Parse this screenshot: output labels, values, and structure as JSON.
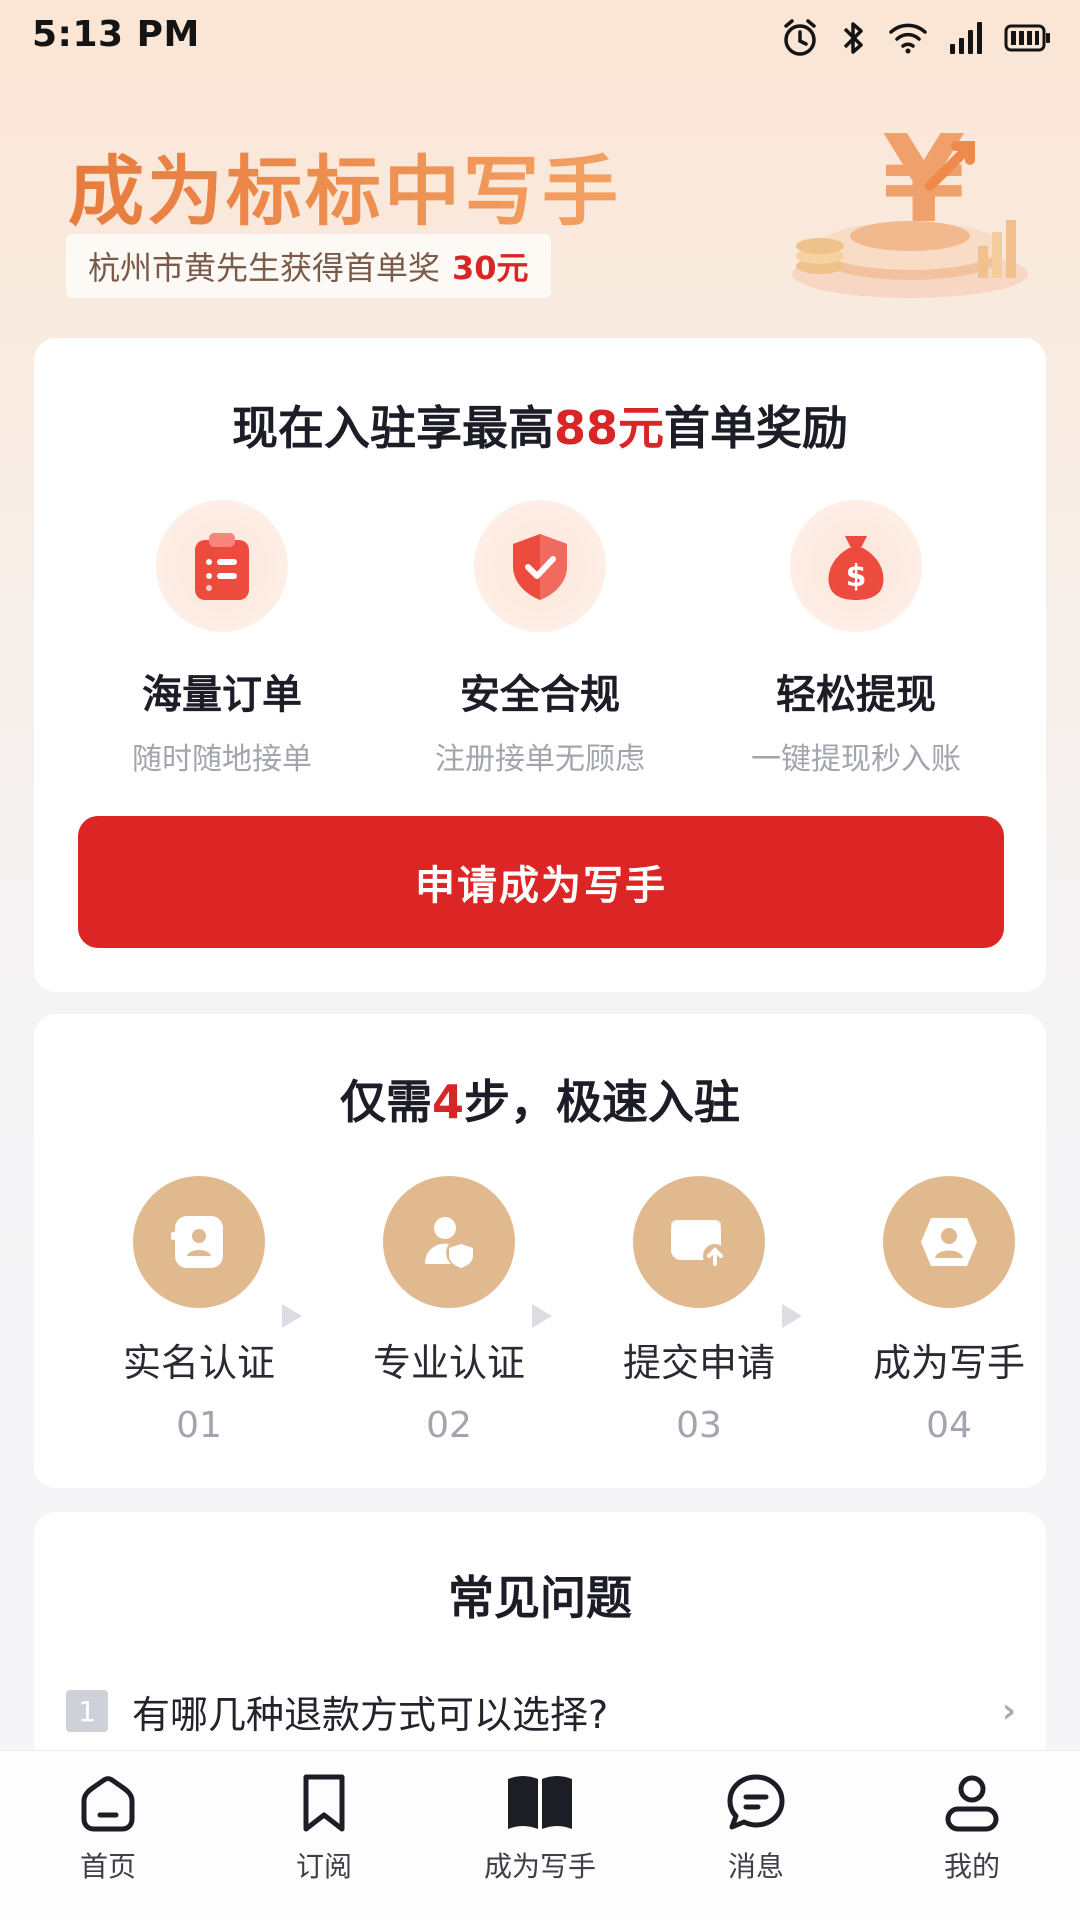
{
  "status_bar": {
    "time": "5:13 PM"
  },
  "hero": {
    "title": "成为标标中写手",
    "subtitle_prefix": "杭州市黄先生获得首单奖",
    "subtitle_amount": "30元"
  },
  "benefits_card": {
    "heading_pre": "现在入驻享最高",
    "heading_highlight": "88元",
    "heading_post": "首单奖励",
    "items": [
      {
        "title": "海量订单",
        "desc": "随时随地接单",
        "icon": "clipboard-list-icon"
      },
      {
        "title": "安全合规",
        "desc": "注册接单无顾虑",
        "icon": "shield-check-icon"
      },
      {
        "title": "轻松提现",
        "desc": "一键提现秒入账",
        "icon": "money-bag-icon"
      }
    ],
    "apply_button": "申请成为写手"
  },
  "steps_card": {
    "heading_pre": "仅需",
    "heading_highlight": "4",
    "heading_post": "步，极速入驻",
    "steps": [
      {
        "label": "实名认证",
        "num": "01",
        "icon": "id-card-icon"
      },
      {
        "label": "专业认证",
        "num": "02",
        "icon": "user-verify-icon"
      },
      {
        "label": "提交申请",
        "num": "03",
        "icon": "submit-upload-icon"
      },
      {
        "label": "成为写手",
        "num": "04",
        "icon": "writer-avatar-icon"
      }
    ]
  },
  "faq_card": {
    "heading": "常见问题",
    "items": [
      {
        "num": "1",
        "text": "有哪几种退款方式可以选择?"
      }
    ]
  },
  "tab_bar": {
    "tabs": [
      {
        "label": "首页",
        "icon": "home-icon"
      },
      {
        "label": "订阅",
        "icon": "bookmark-icon"
      },
      {
        "label": "成为写手",
        "icon": "book-icon",
        "active": true
      },
      {
        "label": "消息",
        "icon": "message-icon"
      },
      {
        "label": "我的",
        "icon": "user-icon"
      }
    ]
  },
  "colors": {
    "accent": "#dc2626",
    "step_icon_bg": "#e0b98f",
    "hero_title": "#ef8d4f"
  }
}
